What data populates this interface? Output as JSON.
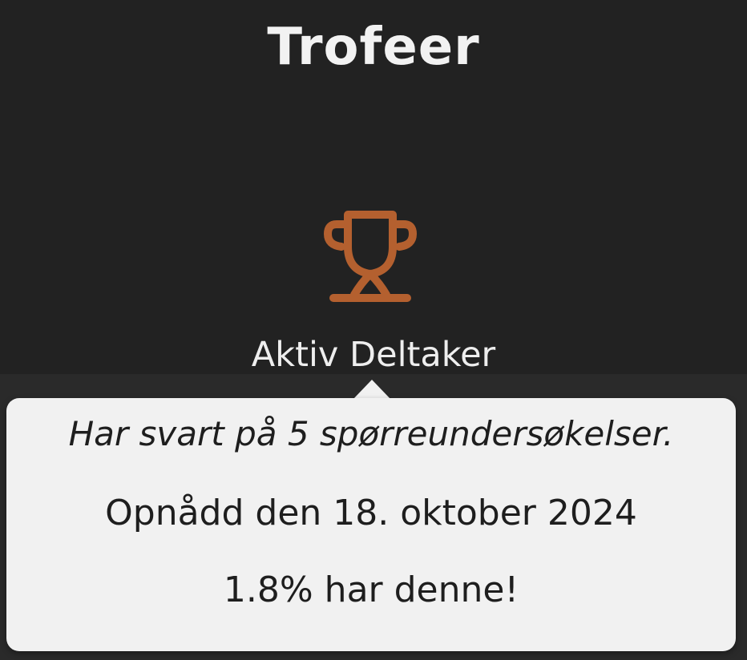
{
  "header": {
    "title": "Trofeer"
  },
  "trophy": {
    "icon": "trophy-icon",
    "name": "Aktiv Deltaker",
    "color": "#b4602f"
  },
  "tooltip": {
    "description": "Har svart på 5 spørreundersøkelser.",
    "achieved": "Opnådd den 18. oktober 2024",
    "percentage": "1.8% har denne!"
  },
  "colors": {
    "background": "#222222",
    "tooltip_bg": "#f1f1f1",
    "text_light": "#f2f2f2",
    "text_dark": "#1e1e1e"
  }
}
